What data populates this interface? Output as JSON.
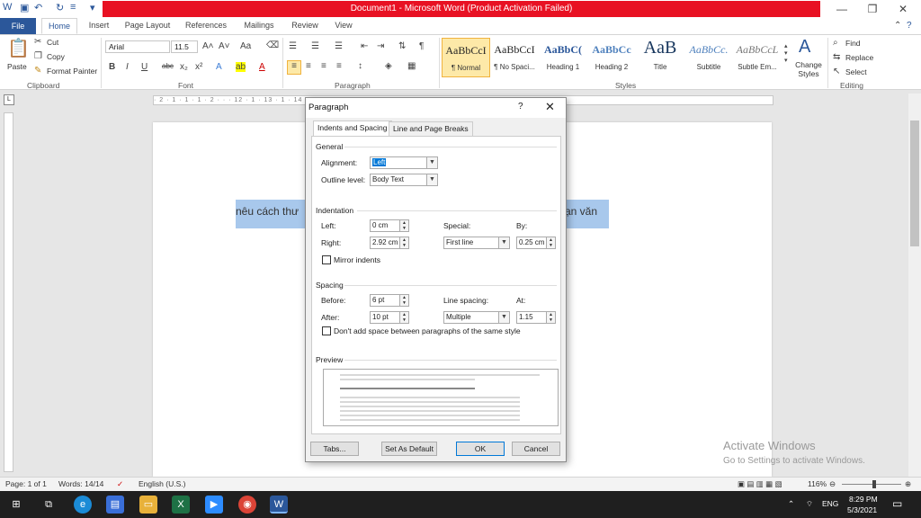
{
  "window": {
    "title": "Document1 - Microsoft Word (Product Activation Failed)"
  },
  "ribbon_tabs": [
    "File",
    "Home",
    "Insert",
    "Page Layout",
    "References",
    "Mailings",
    "Review",
    "View"
  ],
  "clipboard": {
    "paste": "Paste",
    "cut": "Cut",
    "copy": "Copy",
    "format_painter": "Format Painter",
    "label": "Clipboard"
  },
  "font": {
    "name": "Arial",
    "size": "11.5",
    "label": "Font"
  },
  "paragraph_group": {
    "label": "Paragraph"
  },
  "styles": {
    "label": "Styles",
    "items": [
      {
        "sample": "AaBbCcI",
        "name": "¶ Normal"
      },
      {
        "sample": "AaBbCcI",
        "name": "¶ No Spaci..."
      },
      {
        "sample": "AaBbC(",
        "name": "Heading 1"
      },
      {
        "sample": "AaBbCc",
        "name": "Heading 2"
      },
      {
        "sample": "AaB",
        "name": "Title"
      },
      {
        "sample": "AaBbCc.",
        "name": "Subtitle"
      },
      {
        "sample": "AaBbCcL",
        "name": "Subtle Em..."
      }
    ],
    "change_styles": "Change Styles"
  },
  "editing": {
    "find": "Find",
    "replace": "Replace",
    "select": "Select",
    "label": "Editing"
  },
  "ruler_text": "· 2 · 1 · 1 · 1 · 2 · · · 12 · 1 · 13 · 1 · 14 · 1 · 15 · 1 · · · 17 · 1 · 18",
  "document": {
    "text_left": "nêu cách thư",
    "text_right": "ạn văn"
  },
  "dialog": {
    "title": "Paragraph",
    "help": "?",
    "tabs": [
      "Indents and Spacing",
      "Line and Page Breaks"
    ],
    "general": {
      "heading": "General",
      "alignment_label": "Alignment:",
      "alignment_value": "Left",
      "outline_label": "Outline level:",
      "outline_value": "Body Text"
    },
    "indentation": {
      "heading": "Indentation",
      "left_label": "Left:",
      "left_value": "0 cm",
      "right_label": "Right:",
      "right_value": "2.92 cm",
      "special_label": "Special:",
      "special_value": "First line",
      "by_label": "By:",
      "by_value": "0.25 cm",
      "mirror_label": "Mirror indents"
    },
    "spacing": {
      "heading": "Spacing",
      "before_label": "Before:",
      "before_value": "6 pt",
      "after_label": "After:",
      "after_value": "10 pt",
      "line_spacing_label": "Line spacing:",
      "line_spacing_value": "Multiple",
      "at_label": "At:",
      "at_value": "1.15",
      "dont_add_label": "Don't add space between paragraphs of the same style"
    },
    "preview_heading": "Preview",
    "buttons": {
      "tabs": "Tabs...",
      "default": "Set As Default",
      "ok": "OK",
      "cancel": "Cancel"
    }
  },
  "watermark": {
    "line1": "Activate Windows",
    "line2": "Go to Settings to activate Windows."
  },
  "status": {
    "page": "Page: 1 of 1",
    "words": "Words: 14/14",
    "language": "English (U.S.)",
    "zoom": "116%"
  },
  "taskbar": {
    "lang": "ENG",
    "time": "8:29 PM",
    "date": "5/3/2021"
  },
  "colors": {
    "accent": "#2b579a",
    "title_red": "#e81123",
    "selection": "#a8c8ec"
  }
}
